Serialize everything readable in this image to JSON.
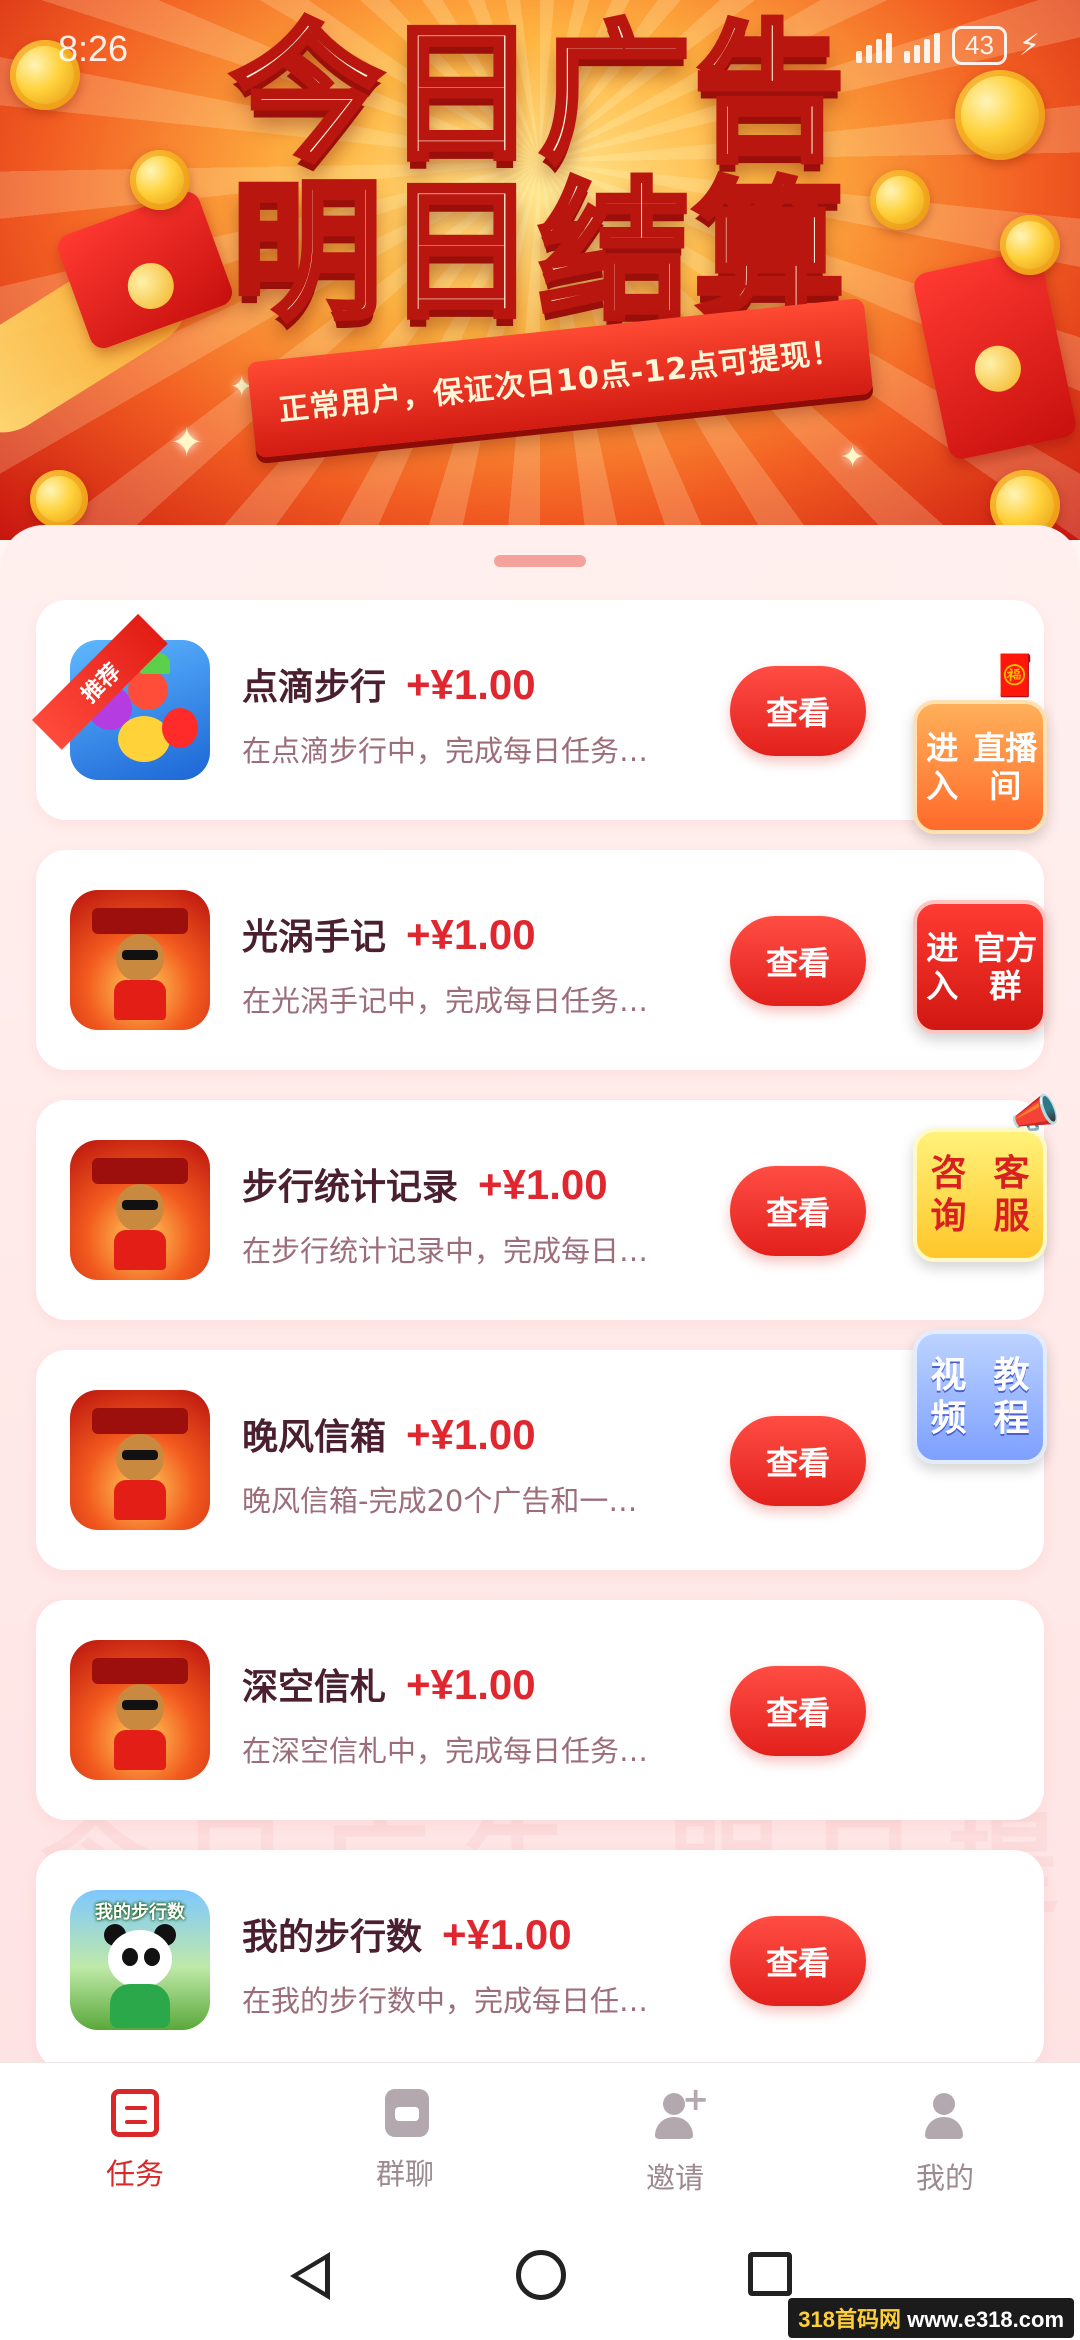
{
  "status_bar": {
    "time": "8:26",
    "battery": "43"
  },
  "banner": {
    "title_line1": "今日广告",
    "title_line2": "明日结算",
    "subtitle": "正常用户，保证次日10点-12点可提现！"
  },
  "tasks": [
    {
      "name": "点滴步行",
      "reward": "+¥1.00",
      "desc": "在点滴步行中，完成每日任务…",
      "button": "查看",
      "badge": "推荐",
      "icon": "fruit-game-icon"
    },
    {
      "name": "光涡手记",
      "reward": "+¥1.00",
      "desc": "在光涡手记中，完成每日任务…",
      "button": "查看",
      "icon": "lucky-bear-icon"
    },
    {
      "name": "步行统计记录",
      "reward": "+¥1.00",
      "desc": "在步行统计记录中，完成每日…",
      "button": "查看",
      "icon": "lucky-bear-icon"
    },
    {
      "name": "晚风信箱",
      "reward": "+¥1.00",
      "desc": "晚风信箱-完成20个广告和一…",
      "button": "查看",
      "icon": "lucky-bear-icon"
    },
    {
      "name": "深空信札",
      "reward": "+¥1.00",
      "desc": "在深空信札中，完成每日任务…",
      "button": "查看",
      "icon": "lucky-bear-icon"
    },
    {
      "name": "我的步行数",
      "reward": "+¥1.00",
      "desc": "在我的步行数中，完成每日任…",
      "button": "查看",
      "icon": "panda-icon",
      "icon_label": "我的步行数"
    }
  ],
  "float_buttons": {
    "live": "进入直播间",
    "group": "进入官方群",
    "service": "咨询客服",
    "video": "视频教程"
  },
  "tab_bar": [
    {
      "label": "任务",
      "icon": "task-list-icon",
      "active": true
    },
    {
      "label": "群聊",
      "icon": "group-chat-icon",
      "active": false
    },
    {
      "label": "邀请",
      "icon": "invite-user-icon",
      "active": false
    },
    {
      "label": "我的",
      "icon": "profile-icon",
      "active": false
    }
  ],
  "watermark": {
    "site_cn": "318首码网",
    "site_en": "www.e318.com"
  },
  "colors": {
    "accent": "#e0262e",
    "button": "#e2201c",
    "tab_active": "#d9282a"
  }
}
